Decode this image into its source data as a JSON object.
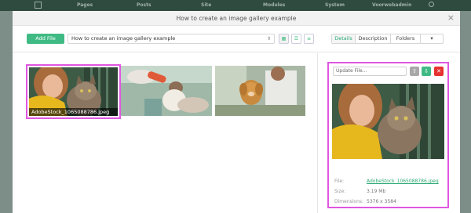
{
  "background_nav": {
    "items": [
      "Pages",
      "Posts",
      "Site",
      "Modules",
      "System",
      "Voorwebadmin"
    ]
  },
  "modal": {
    "title": "How to create an image gallery example",
    "close_label": "×"
  },
  "toolbar": {
    "add_file_label": "Add File",
    "gallery_select_value": "How to create an image gallery example",
    "view_icons": [
      "grid-icon",
      "list-icon",
      "detail-list-icon"
    ]
  },
  "tabs": [
    {
      "label": "Details",
      "active": true
    },
    {
      "label": "Description",
      "active": false
    },
    {
      "label": "Folders",
      "active": false
    },
    {
      "label": "▾",
      "active": false
    }
  ],
  "thumbnails": [
    {
      "caption": "AdobeStock_1065088786.jpeg",
      "selected": true
    },
    {
      "caption": "",
      "selected": false
    },
    {
      "caption": "",
      "selected": false
    }
  ],
  "details": {
    "update_placeholder": "Update File...",
    "buttons": [
      "upload-icon",
      "download-icon",
      "delete-icon"
    ],
    "file_label": "File:",
    "file_value": "AdobeStock_1065088786.jpeg",
    "size_label": "Size:",
    "size_value": "3.19 Mb",
    "dimensions_label": "Dimensions:",
    "dimensions_value": "5376 x 3584"
  },
  "colors": {
    "accent": "#3fba84",
    "selection": "#e056e0",
    "delete": "#e5312f"
  }
}
